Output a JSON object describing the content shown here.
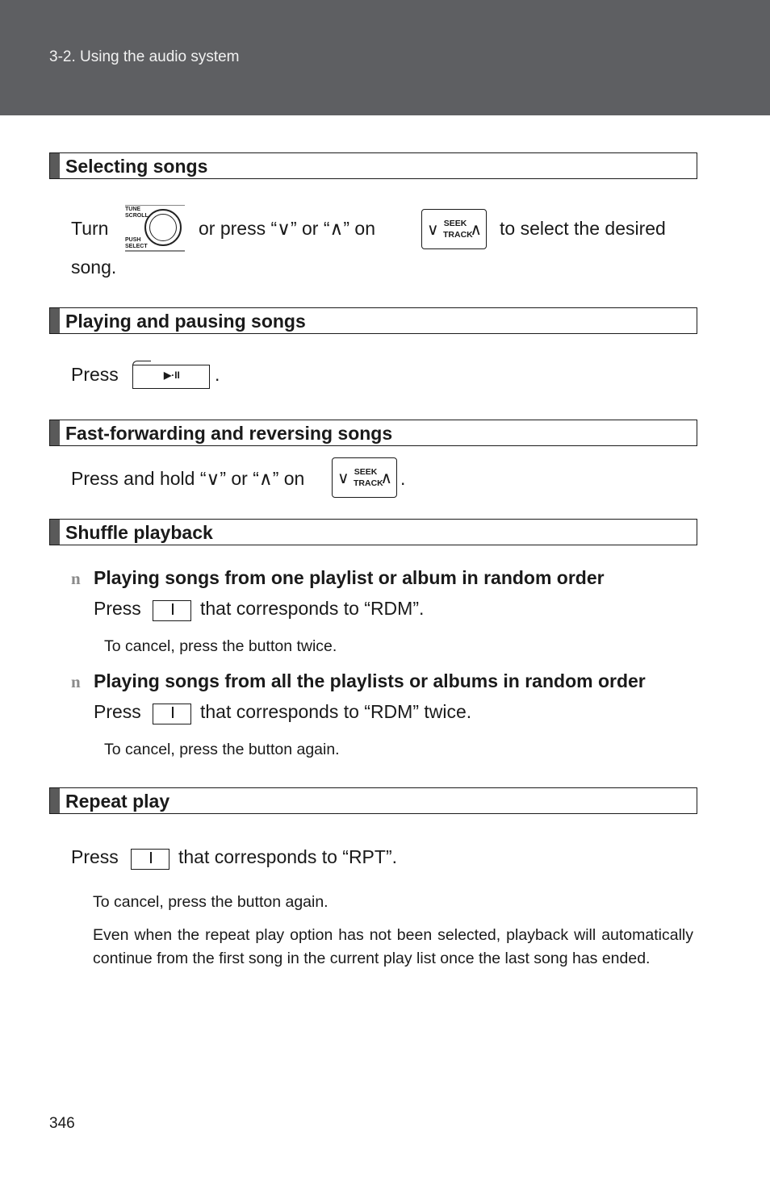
{
  "header": {
    "section": "3-2. Using the audio system"
  },
  "icons": {
    "knob": {
      "top_label_1": "TUNE",
      "top_label_2": "SCROLL",
      "bottom_label_1": "PUSH",
      "bottom_label_2": "SELECT"
    },
    "seek": {
      "down": "∨",
      "up": "∧",
      "label_1": "SEEK",
      "label_2": "TRACK"
    },
    "play": {
      "glyph": "▶·II"
    }
  },
  "sections": [
    {
      "title": "Selecting songs",
      "turn": "Turn",
      "or_press": "or press “∨” or “∧” on",
      "to_select": "to select the desired",
      "song": "song."
    },
    {
      "title": "Playing and pausing songs",
      "press": "Press",
      "dot": "."
    },
    {
      "title": "Fast-forwarding and reversing songs",
      "press_hold": "Press and hold “∨” or “∧” on",
      "dot": "."
    },
    {
      "title": "Shuffle playback",
      "items": [
        {
          "bullet": "n",
          "heading": "Playing songs from one playlist or album in random order",
          "press": "Press",
          "instruction": "that corresponds to “RDM”.",
          "note": "To cancel, press the button twice."
        },
        {
          "bullet": "n",
          "heading": "Playing songs from all the playlists or albums in random order",
          "press": "Press",
          "instruction": "that corresponds to “RDM” twice.",
          "note": "To cancel, press the button again."
        }
      ]
    },
    {
      "title": "Repeat play",
      "press": "Press",
      "instruction": "that corresponds to “RPT”.",
      "note": "To cancel, press the button again.",
      "paragraph": "Even when the repeat play option has not been selected, playback will automatically continue from the first song in the current play list once the last song has ended."
    }
  ],
  "page_number": "346"
}
